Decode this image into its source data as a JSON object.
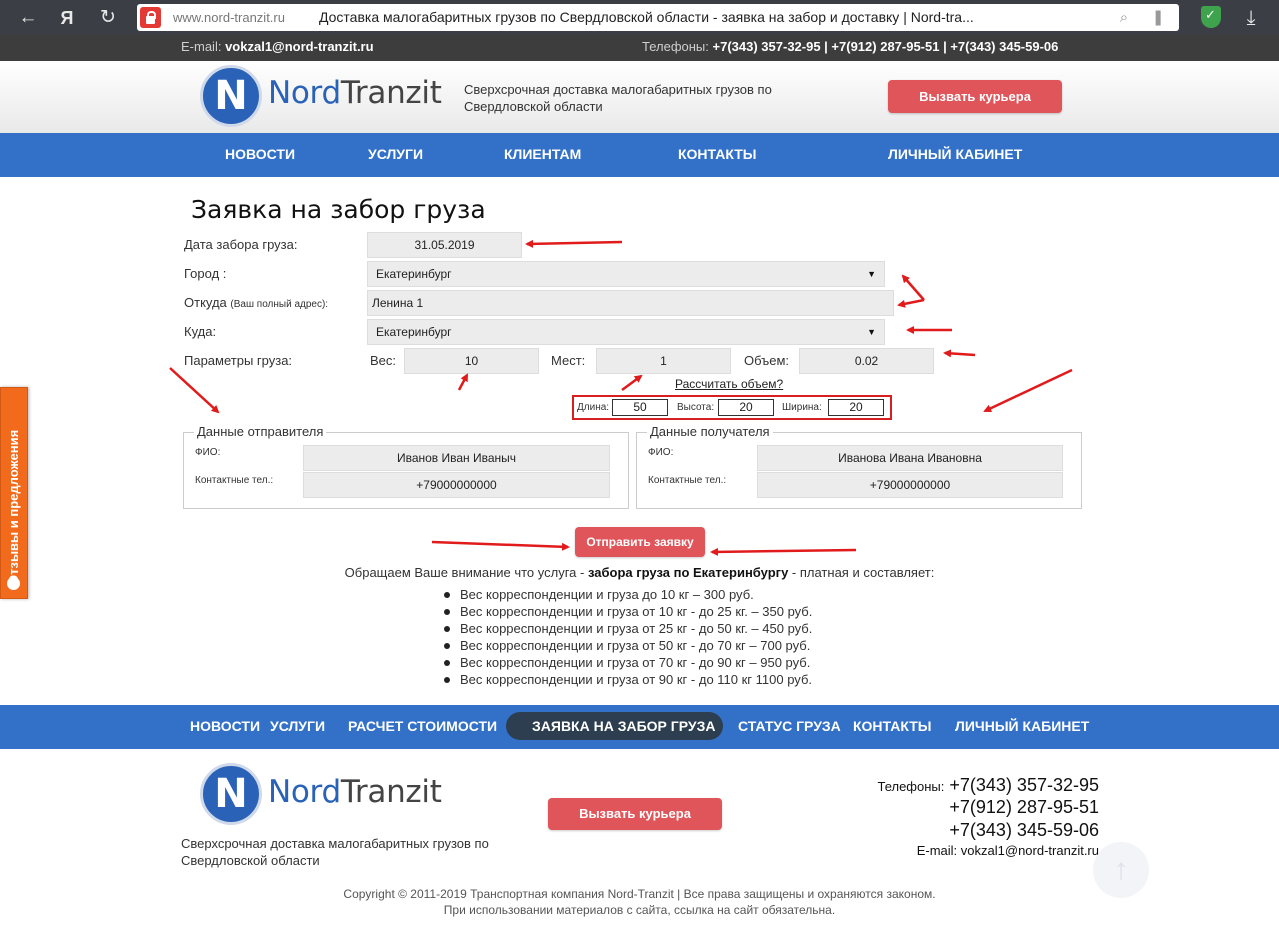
{
  "browser": {
    "back": "←",
    "yandex": "Я",
    "reload": "↻",
    "url": "www.nord-tranzit.ru",
    "title": "Доставка малогабаритных грузов по Свердловской области - заявка на забор и доставку | Nord-tra...",
    "search_glyph": "⌕",
    "bookmark_glyph": "❚",
    "download_glyph": "⤓"
  },
  "topbar": {
    "email_label": "E-mail:",
    "email": "vokzal1@nord-tranzit.ru",
    "phones_label": "Телефоны:",
    "phones": "+7(343) 357-32-95 | +7(912) 287-95-51 | +7(343) 345-59-06"
  },
  "header": {
    "logo_letter": "N",
    "logo_nord": "Nord",
    "logo_tranzit": "Tranzit",
    "tagline": "Сверхсрочная доставка малогабаритных грузов по Свердловской области",
    "courier_button": "Вызвать курьера"
  },
  "menu": [
    "НОВОСТИ",
    "УСЛУГИ",
    "КЛИЕНТАМ",
    "КОНТАКТЫ",
    "ЛИЧНЫЙ КАБИНЕТ"
  ],
  "side_tab": "Отзывы и предложения",
  "form": {
    "title": "Заявка на забор груза",
    "date_label": "Дата забора груза:",
    "date_value": "31.05.2019",
    "city_label": "Город :",
    "city_value": "Екатеринбург",
    "from_label": "Откуда",
    "from_hint": "(Ваш полный адрес):",
    "from_value": "Ленина 1",
    "to_label": "Куда:",
    "to_value": "Екатеринбург",
    "params_label": "Параметры груза:",
    "weight_label": "Вес:",
    "weight_value": "10",
    "places_label": "Мест:",
    "places_value": "1",
    "volume_label": "Объем:",
    "volume_value": "0.02",
    "calc_link": "Рассчитать объем?",
    "length_label": "Длина:",
    "length_value": "50",
    "height_label": "Высота:",
    "height_value": "20",
    "width_label": "Ширина:",
    "width_value": "20",
    "sender": {
      "legend": "Данные отправителя",
      "fio_label": "ФИО:",
      "fio_value": "Иванов Иван Иваныч",
      "phone_label": "Контактные тел.:",
      "phone_value": "+79000000000"
    },
    "recipient": {
      "legend": "Данные получателя",
      "fio_label": "ФИО:",
      "fio_value": "Иванова Ивана Ивановна",
      "phone_label": "Контактные тел.:",
      "phone_value": "+79000000000"
    },
    "submit": "Отправить заявку"
  },
  "notice": {
    "before": "Обращаем Ваше внимание что услуга - ",
    "bold": "забора груза по Екатеринбургу",
    "after": " - платная и составляет:"
  },
  "prices": [
    "Вес корреспонденции и груза до 10 кг – 300 руб.",
    "Вес корреспонденции и груза от 10 кг - до 25 кг. – 350 руб.",
    "Вес корреспонденции и груза от 25 кг - до 50 кг. – 450 руб.",
    "Вес корреспонденции и груза от 50 кг - до 70 кг – 700 руб.",
    "Вес корреспонденции и груза от 70 кг - до 90 кг – 950 руб.",
    "Вес корреспонденции и груза от 90 кг - до 110 кг 1100 руб."
  ],
  "footer_menu": [
    "НОВОСТИ",
    "УСЛУГИ",
    "РАСЧЕТ СТОИМОСТИ",
    "ЗАЯВКА НА ЗАБОР ГРУЗА",
    "СТАТУС ГРУЗА",
    "КОНТАКТЫ",
    "ЛИЧНЫЙ КАБИНЕТ"
  ],
  "footer": {
    "tagline": "Сверхсрочная доставка малогабаритных грузов по Свердловской области",
    "courier_button": "Вызвать курьера",
    "phones_label": "Телефоны:",
    "phone1": "+7(343) 357-32-95",
    "phone2": "+7(912) 287-95-51",
    "phone3": "+7(343) 345-59-06",
    "email_label": "E-mail:",
    "email": "vokzal1@nord-tranzit.ru",
    "copyright1": "Copyright © 2011-2019 Транспортная компания Nord-Tranzit | Все права защищены и охраняются законом.",
    "copyright2": "При использовании материалов с сайта, ссылка на сайт обязательна."
  },
  "colors": {
    "menu_blue": "#3271c7",
    "button_red": "#e0555a",
    "side_tab_orange": "#f26b1d",
    "annotation_red": "#e11b1b"
  }
}
